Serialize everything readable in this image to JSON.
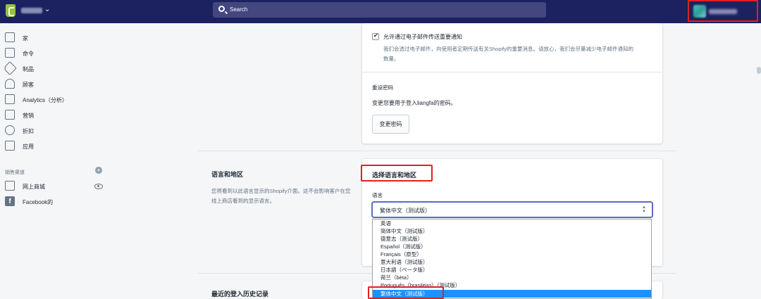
{
  "topbar": {
    "search_placeholder": "Search",
    "icons": {
      "logo": "shopify-bag-icon",
      "search": "search-icon",
      "store_menu": "chevron-down-icon"
    },
    "highlight_color": "#e02020",
    "background": "#1c2260"
  },
  "sidebar": {
    "items": [
      {
        "label": "家",
        "icon": "home-icon"
      },
      {
        "label": "命令",
        "icon": "orders-icon"
      },
      {
        "label": "制品",
        "icon": "tag-icon"
      },
      {
        "label": "顾客",
        "icon": "person-icon"
      },
      {
        "label": "Analytics（分析）",
        "icon": "bar-chart-icon"
      },
      {
        "label": "营销",
        "icon": "megaphone-icon"
      },
      {
        "label": "折扣",
        "icon": "discount-icon"
      },
      {
        "label": "应用",
        "icon": "apps-icon"
      }
    ],
    "sales_channels_title": "销售渠道",
    "channels": [
      {
        "label": "网上商城",
        "icon": "store-icon"
      },
      {
        "label": "Facebook的",
        "icon": "facebook-icon"
      }
    ]
  },
  "notifications": {
    "checkbox_label": "允许通过电子邮件传送重要通知",
    "checked": true,
    "help_line1": "我们会透过电子邮件，向使用者定期传送有关Shopify的重要消息。请放心，我们会尽量减少电子邮件通知的",
    "help_line2": "数量。"
  },
  "password": {
    "title": "重设密码",
    "description": "变更您要用于登入liangfa的密码。",
    "button": "变更密码"
  },
  "language_section": {
    "title": "语言和地区",
    "description": "您将看到以此语言显示的Shopify介面。这不会影响客户在您线上商店看到的显示语言。",
    "card_title": "选择语言和地区",
    "field_label": "语言",
    "selected": "繁体中文（测试版）",
    "options": [
      "英语",
      "简体中文（测试版）",
      "德意志（测试版）",
      "Español（测试版）",
      "Français（原型）",
      "意大利语（测试版）",
      "日本語（ベータ版）",
      "荷兰（bèta）",
      "Português（brasileiro）（测试版）",
      "繁体中文（测试版）"
    ],
    "highlighted_option_index": 9,
    "highlight_color": "#1e90ff"
  },
  "login_history": {
    "title": "最近的登入历史记录"
  }
}
